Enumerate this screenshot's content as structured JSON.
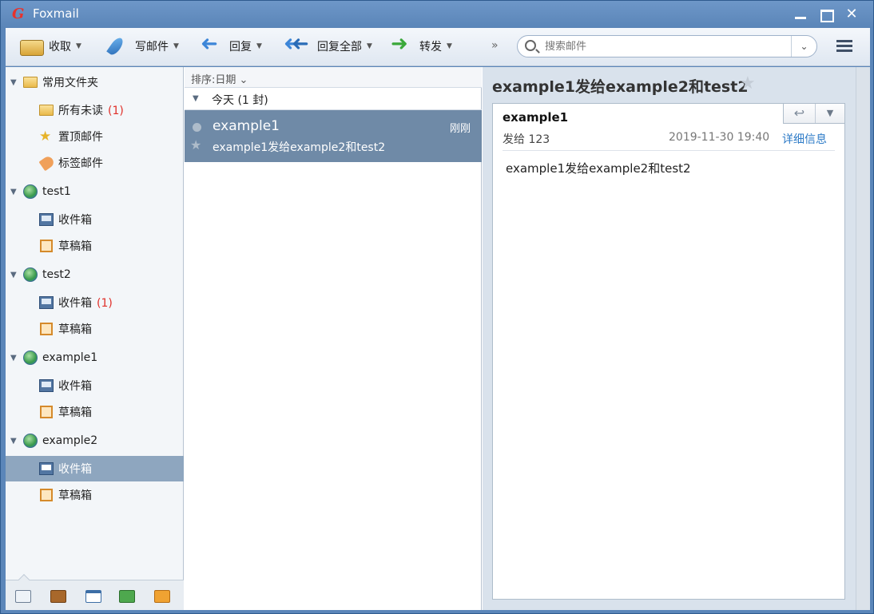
{
  "window": {
    "title": "Foxmail",
    "logo_text": "G"
  },
  "toolbar": {
    "receive_label": "收取",
    "write_label": "写邮件",
    "reply_label": "回复",
    "reply_all_label": "回复全部",
    "forward_label": "转发",
    "more_label": "»",
    "search_placeholder": "搜索邮件",
    "search_drop_label": "⌄"
  },
  "sidebar": {
    "favorites": {
      "label": "常用文件夹",
      "items": [
        {
          "label": "所有未读",
          "count": "(1)"
        },
        {
          "label": "置顶邮件",
          "count": ""
        },
        {
          "label": "标签邮件",
          "count": ""
        }
      ]
    },
    "accounts": [
      {
        "name": "test1",
        "folders": [
          {
            "label": "收件箱",
            "count": ""
          },
          {
            "label": "草稿箱",
            "count": ""
          }
        ]
      },
      {
        "name": "test2",
        "folders": [
          {
            "label": "收件箱",
            "count": "(1)"
          },
          {
            "label": "草稿箱",
            "count": ""
          }
        ]
      },
      {
        "name": "example1",
        "folders": [
          {
            "label": "收件箱",
            "count": ""
          },
          {
            "label": "草稿箱",
            "count": ""
          }
        ]
      },
      {
        "name": "example2",
        "folders": [
          {
            "label": "收件箱",
            "count": ""
          },
          {
            "label": "草稿箱",
            "count": ""
          }
        ]
      }
    ],
    "selected": "example2/收件箱"
  },
  "message_list": {
    "sort_label": "排序:日期 ⌄",
    "group_label": "今天 (1 封)",
    "messages": [
      {
        "from": "example1",
        "time": "刚刚",
        "subject": "example1发给example2和test2"
      }
    ]
  },
  "reader": {
    "subject": "example1发给example2和test2",
    "from": "example1",
    "to": "发给 123",
    "date": "2019-11-30 19:40",
    "detail_link": "详细信息",
    "body": "example1发给example2和test2"
  },
  "colors": {
    "titlebar": "#5a85b8",
    "selection": "#8ea6bf",
    "message_selected": "#6f8aa7",
    "unread": "#e0302a",
    "link": "#2d7bc7"
  }
}
